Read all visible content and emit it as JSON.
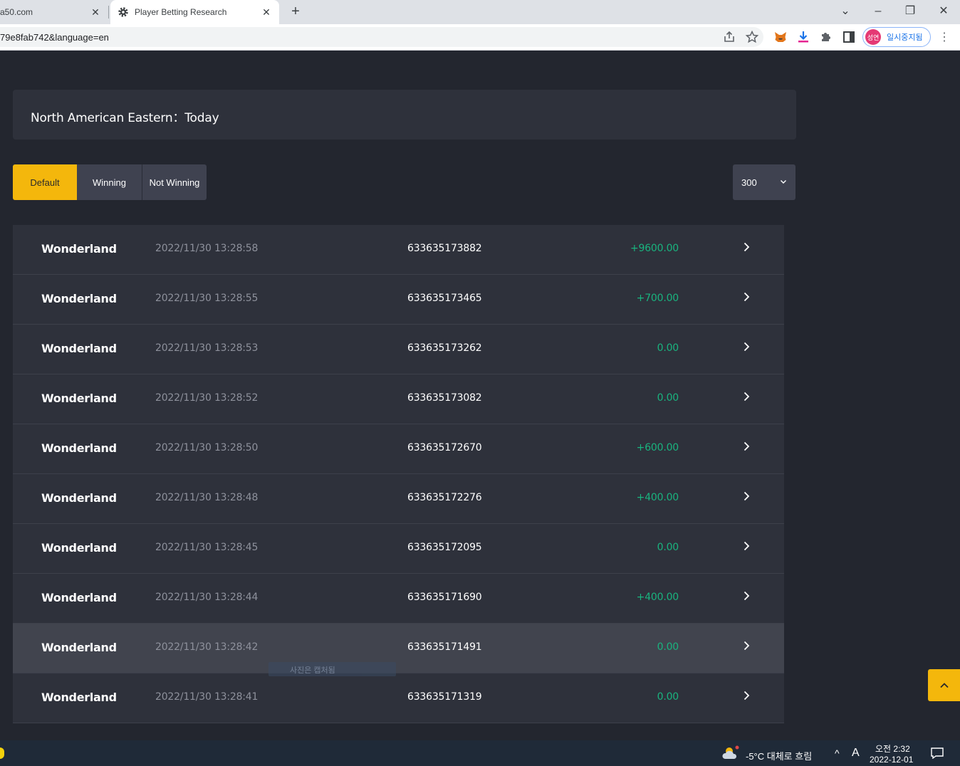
{
  "browser": {
    "tabs": [
      {
        "label": "a50.com",
        "active": false
      },
      {
        "label": "Player Betting Research",
        "active": true
      }
    ],
    "url": "79e8fab742&language=en",
    "profile": {
      "avatar_text": "성연",
      "status": "일시중지됨"
    }
  },
  "timezone": {
    "label": "North American Eastern：Today"
  },
  "filters": {
    "default": "Default",
    "winning": "Winning",
    "not_winning": "Not Winning",
    "active": "Default"
  },
  "page_size": {
    "value": "300"
  },
  "rows": [
    {
      "game": "Wonderland",
      "time": "2022/11/30 13:28:58",
      "id": "633635173882",
      "amount": "+9600.00"
    },
    {
      "game": "Wonderland",
      "time": "2022/11/30 13:28:55",
      "id": "633635173465",
      "amount": "+700.00"
    },
    {
      "game": "Wonderland",
      "time": "2022/11/30 13:28:53",
      "id": "633635173262",
      "amount": "0.00"
    },
    {
      "game": "Wonderland",
      "time": "2022/11/30 13:28:52",
      "id": "633635173082",
      "amount": "0.00"
    },
    {
      "game": "Wonderland",
      "time": "2022/11/30 13:28:50",
      "id": "633635172670",
      "amount": "+600.00"
    },
    {
      "game": "Wonderland",
      "time": "2022/11/30 13:28:48",
      "id": "633635172276",
      "amount": "+400.00"
    },
    {
      "game": "Wonderland",
      "time": "2022/11/30 13:28:45",
      "id": "633635172095",
      "amount": "0.00"
    },
    {
      "game": "Wonderland",
      "time": "2022/11/30 13:28:44",
      "id": "633635171690",
      "amount": "+400.00"
    },
    {
      "game": "Wonderland",
      "time": "2022/11/30 13:28:42",
      "id": "633635171491",
      "amount": "0.00"
    },
    {
      "game": "Wonderland",
      "time": "2022/11/30 13:28:41",
      "id": "633635171319",
      "amount": "0.00"
    }
  ],
  "overlay": {
    "text": "사진은 캡처됨"
  },
  "colors": {
    "accent": "#f4b70c",
    "win": "#19b47f",
    "row_bg": "#2e313b",
    "page_bg": "#23262f"
  },
  "taskbar": {
    "weather": "-5°C  대체로 흐림",
    "ime": "A",
    "time": "오전 2:32",
    "date": "2022-12-01"
  }
}
